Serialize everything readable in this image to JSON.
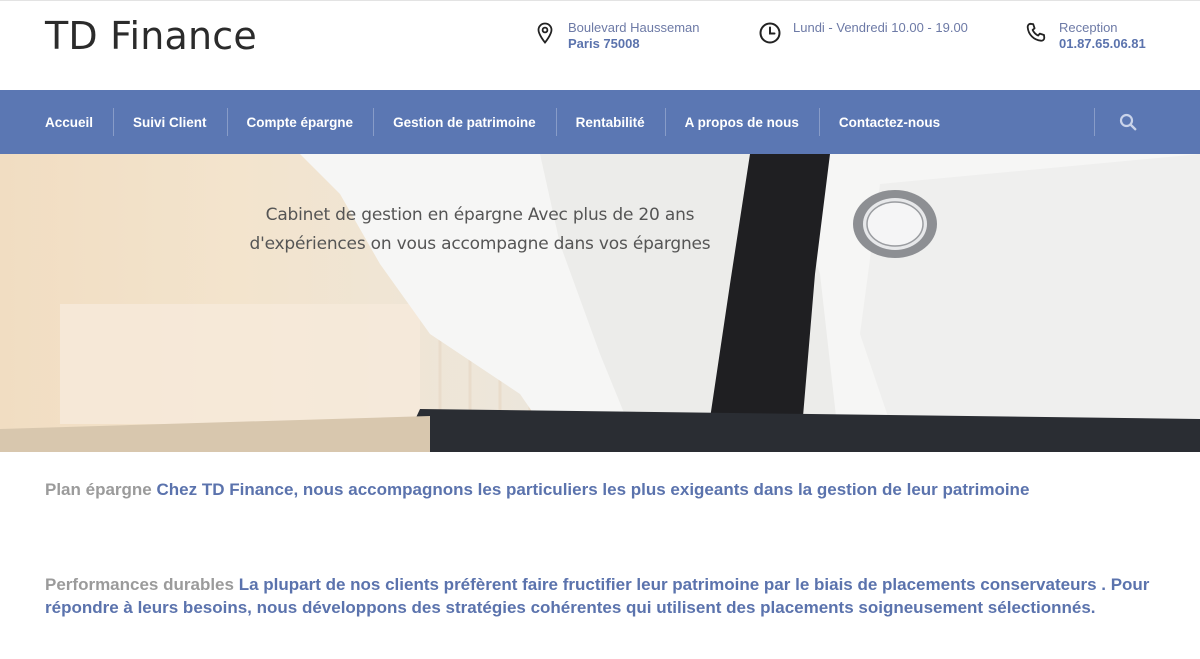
{
  "header": {
    "logo": "TD Finance",
    "address": {
      "icon": "location-pin-icon",
      "line1": "Boulevard Hausseman",
      "line2": "Paris 75008"
    },
    "hours": {
      "icon": "clock-icon",
      "line1": "Lundi - Vendredi 10.00 - 19.00"
    },
    "phone": {
      "icon": "phone-icon",
      "line1": "Reception",
      "line2": "01.87.65.06.81"
    }
  },
  "nav": {
    "items": [
      {
        "label": "Accueil"
      },
      {
        "label": "Suivi Client"
      },
      {
        "label": "Compte épargne"
      },
      {
        "label": "Gestion de patrimoine"
      },
      {
        "label": "Rentabilité"
      },
      {
        "label": "A propos de nous"
      },
      {
        "label": "Contactez-nous"
      }
    ],
    "search_icon": "search-icon"
  },
  "hero": {
    "line1": "Cabinet de gestion en épargne Avec plus de 20 ans",
    "line2": "d'expériences on vous accompagne dans vos épargnes"
  },
  "content": {
    "para1": {
      "lead": "Plan épargne",
      "body": "Chez TD Finance, nous accompagnons les particuliers les plus exigeants dans la gestion de leur patrimoine"
    },
    "para2": {
      "lead": "Performances durables",
      "body": "La plupart de nos clients préfèrent faire fructifier leur patrimoine par le biais de placements conservateurs . Pour répondre à leurs besoins, nous développons des stratégies cohérentes qui utilisent des placements soigneusement sélectionnés."
    }
  },
  "colors": {
    "nav_bg": "#5b77b3",
    "accent_text": "#5b73ad",
    "muted_text": "#9b9b9b"
  }
}
